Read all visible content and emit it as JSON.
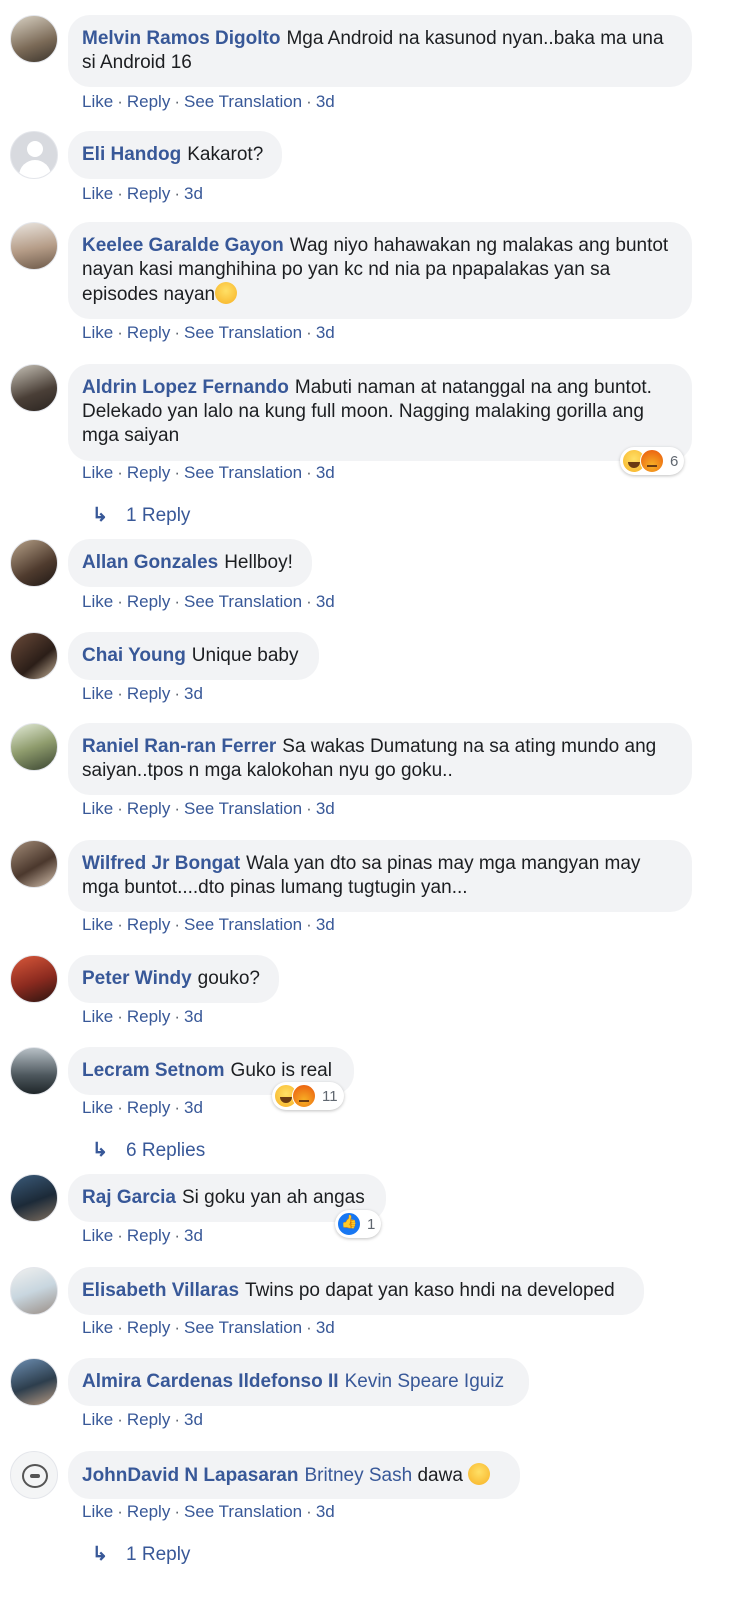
{
  "actions": {
    "like": "Like",
    "reply": "Reply",
    "translate": "See Translation",
    "sep": "·"
  },
  "comments": [
    {
      "name": "Melvin Ramos Digolto",
      "text": "Mga Android na kasunod nyan..baka ma una si Android 16",
      "time": "3d",
      "translate": true
    },
    {
      "name": "Eli Handog",
      "text": "Kakarot?",
      "time": "3d",
      "translate": false
    },
    {
      "name": "Keelee Garalde Gayon",
      "text": "Wag niyo hahawakan ng malakas ang buntot nayan kasi manghihina po yan kc nd nia pa npapalakas yan sa episodes nayan",
      "emoji": "laughing-tears",
      "time": "3d",
      "translate": true
    },
    {
      "name": "Aldrin Lopez Fernando",
      "text": "Mabuti naman at natanggal na ang buntot. Delekado yan lalo na kung full moon. Nagging malaking gorilla ang mga saiyan",
      "time": "3d",
      "translate": true,
      "reactions": {
        "types": [
          "haha",
          "angry"
        ],
        "count": "6"
      },
      "replies": "1 Reply"
    },
    {
      "name": "Allan Gonzales",
      "text": "Hellboy!",
      "time": "3d",
      "translate": true
    },
    {
      "name": "Chai Young",
      "text": "Unique baby",
      "time": "3d",
      "translate": false
    },
    {
      "name": "Raniel Ran-ran Ferrer",
      "text": "Sa wakas Dumatung na sa ating mundo ang saiyan..tpos n mga kalokohan nyu go goku..",
      "time": "3d",
      "translate": true
    },
    {
      "name": "Wilfred Jr Bongat",
      "text": "Wala yan dto sa pinas may mga mangyan may mga buntot....dto pinas lumang tugtugin yan...",
      "time": "3d",
      "translate": true
    },
    {
      "name": "Peter Windy",
      "text": "gouko?",
      "time": "3d",
      "translate": false
    },
    {
      "name": "Lecram Setnom",
      "text": "Guko is real",
      "time": "3d",
      "translate": false,
      "reactions": {
        "types": [
          "haha",
          "angry"
        ],
        "count": "11"
      },
      "replies": "6 Replies"
    },
    {
      "name": "Raj Garcia",
      "text": "Si goku yan ah angas",
      "time": "3d",
      "translate": false,
      "reactions": {
        "types": [
          "like"
        ],
        "count": "1"
      }
    },
    {
      "name": "Elisabeth Villaras",
      "text": "Twins po dapat yan kaso hndi na developed",
      "time": "3d",
      "translate": true
    },
    {
      "name": "Almira Cardenas Ildefonso II",
      "mention": "Kevin Speare Iguiz",
      "text": "",
      "time": "3d",
      "translate": false
    },
    {
      "name": "JohnDavid N Lapasaran",
      "mention": "Britney Sash",
      "text": "dawa",
      "emoji": "upside-down-face",
      "time": "3d",
      "translate": true,
      "replies": "1 Reply"
    }
  ],
  "reply_arrow": "↳"
}
